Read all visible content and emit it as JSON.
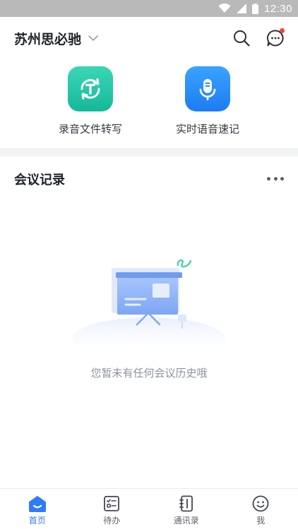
{
  "status_bar": {
    "time": "12:30",
    "icons": [
      "wifi-icon",
      "signal-icon",
      "battery-icon"
    ]
  },
  "header": {
    "org_name": "苏州思必驰",
    "icons": [
      "chevron-down-icon",
      "search-icon",
      "chat-icon"
    ],
    "has_notification": true
  },
  "actions": [
    {
      "label": "录音文件转写",
      "icon": "transcribe-icon",
      "color": "#1fc3a3"
    },
    {
      "label": "实时语音速记",
      "icon": "microphone-icon",
      "color": "#2a8cfb"
    }
  ],
  "meetings": {
    "title": "会议记录",
    "more_icon": "more-dots-icon",
    "empty_text": "您暂未有任何会议历史哦",
    "empty_icon": "presentation-board-icon"
  },
  "tabbar": {
    "active": "首页",
    "tabs": [
      {
        "label": "首页",
        "icon": "home-icon"
      },
      {
        "label": "待办",
        "icon": "todo-list-icon"
      },
      {
        "label": "通讯录",
        "icon": "contacts-icon"
      },
      {
        "label": "我",
        "icon": "smiley-icon"
      }
    ]
  },
  "colors": {
    "accent": "#2f7bf5",
    "green": "#1fc3a3",
    "badge_red": "#f0453a"
  }
}
